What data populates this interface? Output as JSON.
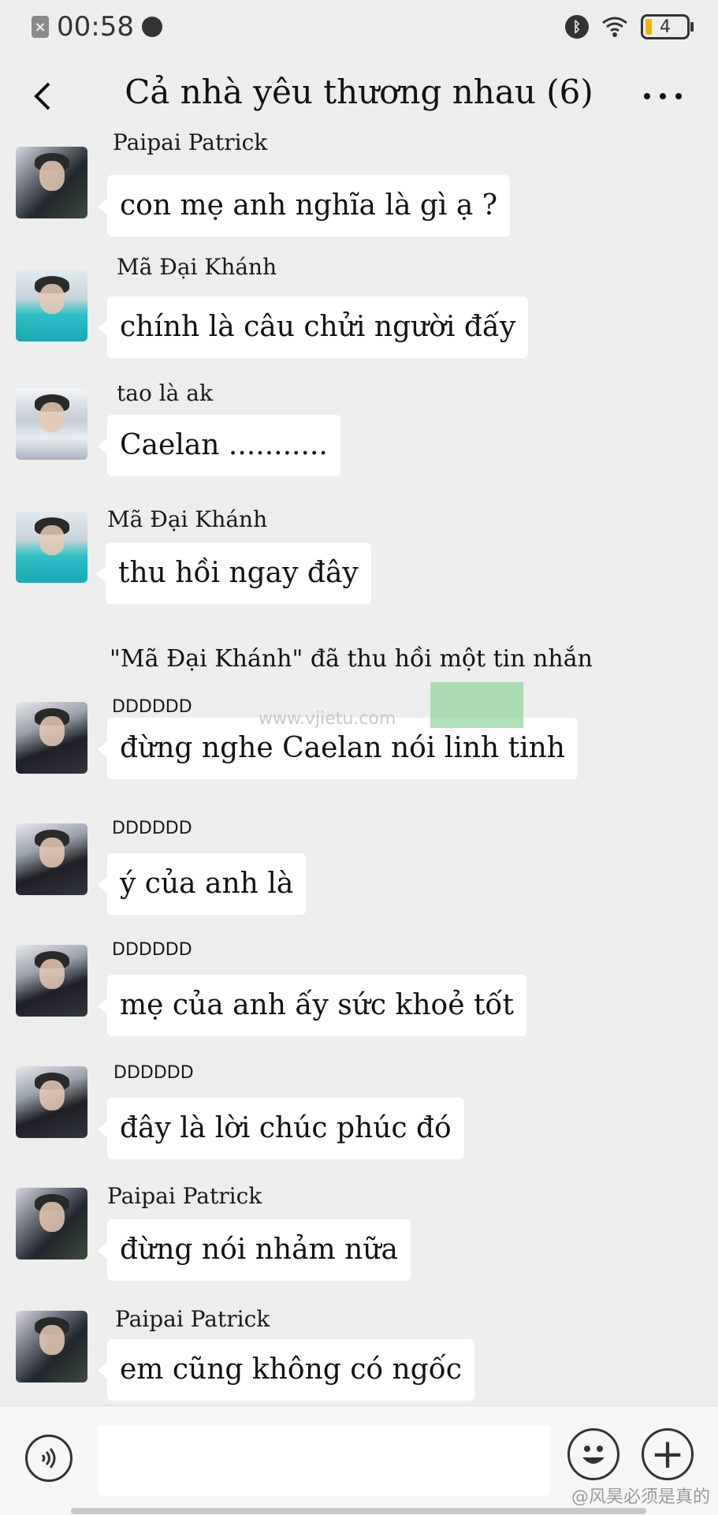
{
  "status_bar": {
    "time": "00:58",
    "battery": "4",
    "left_icon": "notification-off-icon",
    "colors": {
      "battery_fill": "#f0b400"
    }
  },
  "header": {
    "title": "Cả nhà yêu thương nhau (6)",
    "back_icon": "chevron-left-icon",
    "more_icon": "more-dots-icon"
  },
  "messages": [
    {
      "sender": "Paipai Patrick",
      "text": "con mẹ anh nghĩa là gì ạ ?"
    },
    {
      "sender": "Mã Đại Khánh",
      "text": "chính là câu chửi người đấy"
    },
    {
      "sender": "tao là ak",
      "text": "Caelan ..........."
    },
    {
      "sender": "Mã Đại Khánh",
      "text": "thu hồi ngay đây"
    },
    {
      "system": "\"Mã Đại Khánh\" đã thu hồi một tin nhắn"
    },
    {
      "sender": "DDDDDD",
      "text": "đừng nghe Caelan nói linh tinh"
    },
    {
      "sender": "DDDDDD",
      "text": "ý của anh là"
    },
    {
      "sender": "DDDDDD",
      "text": "mẹ của anh ấy sức khoẻ tốt"
    },
    {
      "sender": "DDDDDD",
      "text": "đây là lời chúc phúc đó"
    },
    {
      "sender": "Paipai Patrick",
      "text": "đừng nói nhảm nữa"
    },
    {
      "sender": "Paipai Patrick",
      "text": "em cũng không có ngốc"
    }
  ],
  "watermark": {
    "text": "www.vjietu.com"
  },
  "input_bar": {
    "voice_icon": "voice-icon",
    "emoji_icon": "emoji-icon",
    "plus_icon": "plus-icon",
    "message_value": ""
  },
  "credit": "@风昊必须是真的"
}
